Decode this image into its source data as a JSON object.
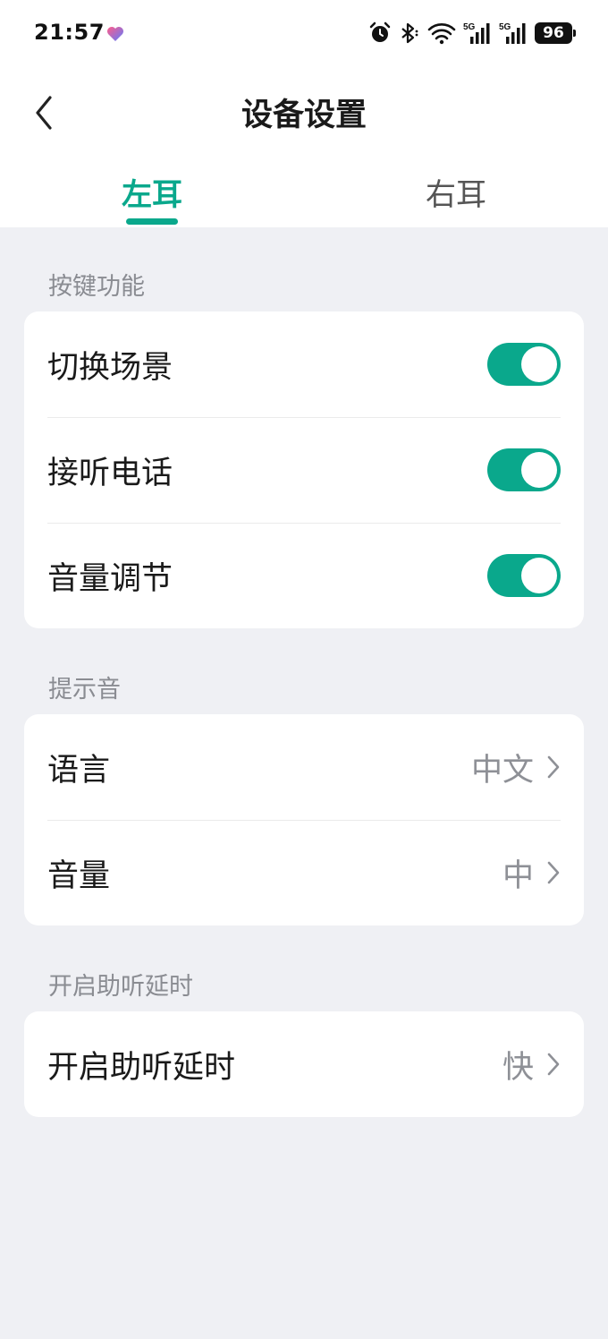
{
  "status_bar": {
    "time": "21:57",
    "battery": "96",
    "icons": [
      "health-heart-icon",
      "alarm-icon",
      "bluetooth-icon",
      "wifi-icon",
      "signal-5g-icon",
      "signal-5g-icon"
    ]
  },
  "nav": {
    "title": "设备设置",
    "back_icon": "chevron-left-icon"
  },
  "tabs": [
    {
      "label": "左耳",
      "active": true
    },
    {
      "label": "右耳",
      "active": false
    }
  ],
  "sections": {
    "key_function": {
      "label": "按键功能",
      "items": [
        {
          "label": "切换场景",
          "toggle": true
        },
        {
          "label": "接听电话",
          "toggle": true
        },
        {
          "label": "音量调节",
          "toggle": true
        }
      ]
    },
    "prompt_tone": {
      "label": "提示音",
      "items": [
        {
          "label": "语言",
          "value": "中文"
        },
        {
          "label": "音量",
          "value": "中"
        }
      ]
    },
    "hearing_delay": {
      "label": "开启助听延时",
      "items": [
        {
          "label": "开启助听延时",
          "value": "快"
        }
      ]
    }
  },
  "colors": {
    "accent": "#0aa88c",
    "background": "#eff0f4",
    "card": "#ffffff",
    "secondary_text": "#8e9096"
  }
}
